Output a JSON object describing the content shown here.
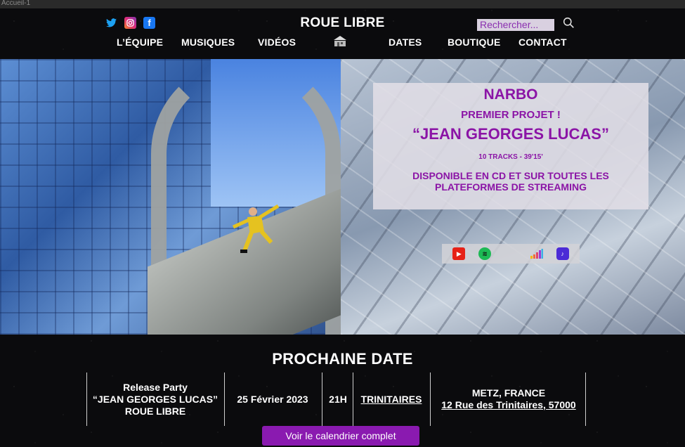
{
  "browser": {
    "tab_title": "Accueil-1"
  },
  "header": {
    "brand": "ROUE LIBRE",
    "search_placeholder": "Rechercher...",
    "social": [
      "twitter-icon",
      "instagram-icon",
      "facebook-icon"
    ],
    "nav": [
      "L’ÉQUIPE",
      "MUSIQUES",
      "VIDÉOS",
      "DATES",
      "BOUTIQUE",
      "CONTACT"
    ]
  },
  "promo": {
    "artist": "NARBO",
    "tagline": "PREMIER PROJET !",
    "album": "“JEAN GEORGES LUCAS”",
    "tracks": "10 TRACKS - 39'15'",
    "availability": "DISPONIBLE EN CD ET SUR TOUTES LES PLATEFORMES DE STREAMING",
    "platforms": [
      "youtube-icon",
      "spotify-icon",
      "apple-icon",
      "deezer-icon",
      "amazon-music-icon"
    ]
  },
  "next_date": {
    "heading": "PROCHAINE DATE",
    "event": {
      "line1": "Release Party",
      "line2": "“JEAN GEORGES LUCAS”",
      "line3": "ROUE LIBRE",
      "date": "25 Février 2023",
      "time": "21H",
      "venue": "TRINITAIRES",
      "city": "METZ, FRANCE",
      "address": "12 Rue des Trinitaires, 57000"
    },
    "cta": "Voir le calendrier complet"
  },
  "colors": {
    "accent": "#8a1ab0",
    "promo_text": "#8b14a6",
    "background": "#0b0b0d"
  }
}
